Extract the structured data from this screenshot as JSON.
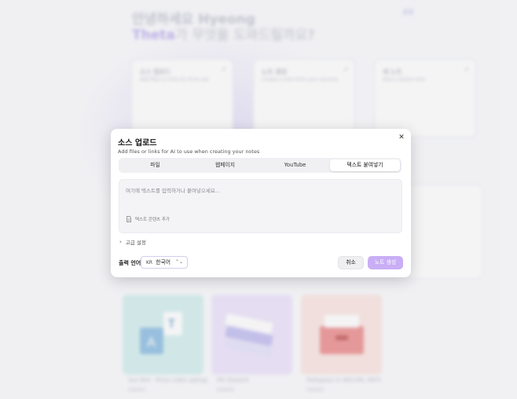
{
  "background": {
    "greeting_line1": "안녕하세요 Hyeong",
    "greeting_line2_accent": "Theta",
    "greeting_line2_rest": "가 무엇을 도와드릴까요?",
    "share_label": "공유",
    "cards": [
      {
        "title": "소스 업로드",
        "desc": "Add files or links for AI to use"
      },
      {
        "title": "노트 생성",
        "desc": "Create a note from your sources"
      },
      {
        "title": "새 노트",
        "desc": "Start a blank note"
      }
    ],
    "tiles": [
      {
        "label": "Sse 4K4 - Pinzo cidbe aplkag",
        "color": "#d9f1f0"
      },
      {
        "label": "Plk Glosse4",
        "color": "#efe7fb"
      },
      {
        "label": "Todoglass nt 4K8 HM, 4KF5",
        "color": "#fbe9e5"
      }
    ]
  },
  "modal": {
    "title": "소스 업로드",
    "subtitle": "Add files or links for AI to use when creating your notes",
    "tabs": [
      {
        "label": "파일",
        "active": false
      },
      {
        "label": "웹페이지",
        "active": false
      },
      {
        "label": "YouTube",
        "active": false
      },
      {
        "label": "텍스트 붙여넣기",
        "active": true
      }
    ],
    "textarea_placeholder": "여기에 텍스트를 입력하거나 붙여넣으세요...",
    "add_text_content": "텍스트 콘텐츠 추가",
    "advanced_label": "고급 설정",
    "output_language_label": "출력 언어:",
    "output_language_code": "KR",
    "output_language_value": "한국어",
    "cancel_label": "취소",
    "create_label": "노트 생성"
  },
  "colors": {
    "accent": "#c9aef5",
    "modal_bg": "#ffffff",
    "page_bg": "#fbfbfd"
  }
}
